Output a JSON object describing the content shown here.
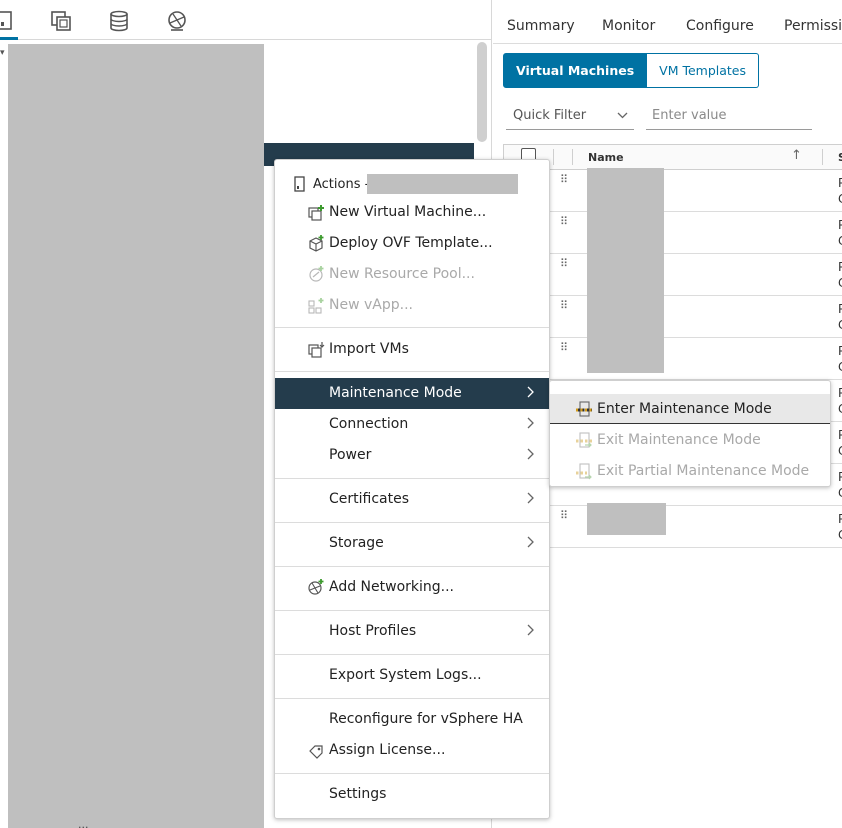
{
  "left_nav": {
    "tabs": [
      {
        "icon": "hosts-and-clusters-icon"
      },
      {
        "icon": "vms-and-templates-icon"
      },
      {
        "icon": "storage-icon"
      },
      {
        "icon": "networking-icon"
      }
    ],
    "active_tab_color": "#0072a3",
    "bottom_partial_label": "...",
    "selected_row_color": "#243c4c"
  },
  "right_pane": {
    "tabs": [
      "Summary",
      "Monitor",
      "Configure",
      "Permissi"
    ],
    "segmented": {
      "options": [
        "Virtual Machines",
        "VM Templates"
      ],
      "selected": "Virtual Machines",
      "accent": "#0072a3"
    },
    "filter": {
      "dropdown_label": "Quick Filter",
      "input_placeholder": "Enter value"
    },
    "grid": {
      "columns": [
        "Name",
        "S"
      ],
      "rows": [
        {
          "c1": "P",
          "c2": "C"
        },
        {
          "c1": "P",
          "c2": "C"
        },
        {
          "c1": "P",
          "c2": "C"
        },
        {
          "c1": "P",
          "c2": "C"
        },
        {
          "c1": "P",
          "c2": "C"
        },
        {
          "c1": "P",
          "c2": "C"
        },
        {
          "c1": "P",
          "c2": "C"
        },
        {
          "c1": "P",
          "c2": "C"
        },
        {
          "c1": "P",
          "c2": "C"
        }
      ]
    }
  },
  "context_menu": {
    "header": "Actions -",
    "items": [
      {
        "label": "New Virtual Machine...",
        "icon": "new-vm-icon",
        "disabled": false
      },
      {
        "label": "Deploy OVF Template...",
        "icon": "deploy-ovf-icon",
        "disabled": false
      },
      {
        "label": "New Resource Pool...",
        "icon": "resource-pool-icon",
        "disabled": true
      },
      {
        "label": "New vApp...",
        "icon": "vapp-icon",
        "disabled": true
      },
      {
        "label": "Import VMs",
        "icon": "import-vms-icon",
        "disabled": false
      },
      {
        "label": "Maintenance Mode",
        "submenu": true,
        "highlighted": true
      },
      {
        "label": "Connection",
        "submenu": true
      },
      {
        "label": "Power",
        "submenu": true
      },
      {
        "label": "Certificates",
        "submenu": true
      },
      {
        "label": "Storage",
        "submenu": true
      },
      {
        "label": "Add Networking...",
        "icon": "add-networking-icon"
      },
      {
        "label": "Host Profiles",
        "submenu": true
      },
      {
        "label": "Export System Logs..."
      },
      {
        "label": "Reconfigure for vSphere HA"
      },
      {
        "label": "Assign License...",
        "icon": "license-key-icon"
      },
      {
        "label": "Settings"
      }
    ]
  },
  "maintenance_submenu": {
    "items": [
      {
        "label": "Enter Maintenance Mode",
        "icon": "enter-maintenance-icon",
        "disabled": false,
        "hovered": true
      },
      {
        "label": "Exit Maintenance Mode",
        "icon": "exit-maintenance-icon",
        "disabled": true
      },
      {
        "label": "Exit Partial Maintenance Mode",
        "icon": "exit-partial-maintenance-icon",
        "disabled": true
      }
    ]
  }
}
